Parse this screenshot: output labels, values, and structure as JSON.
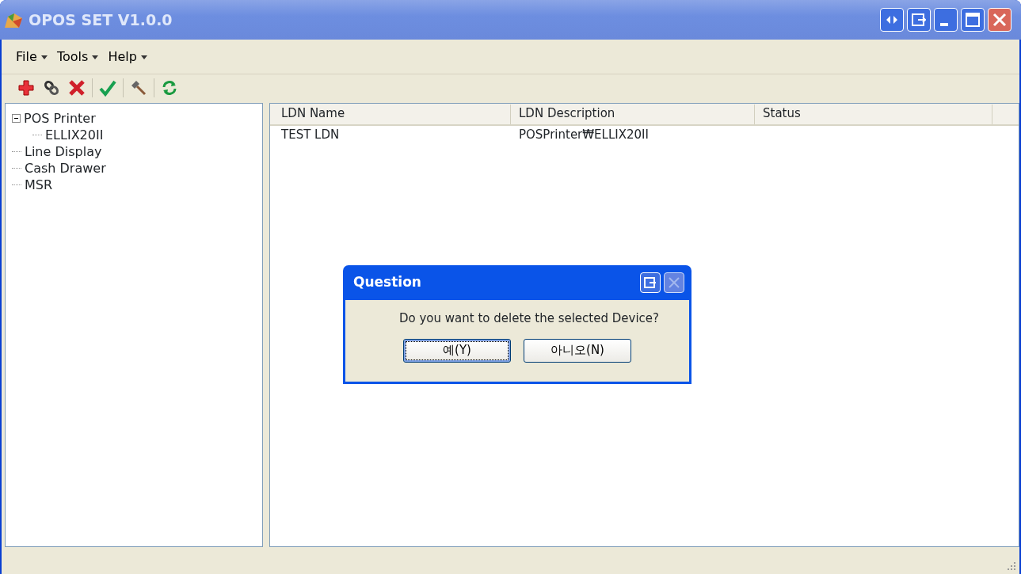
{
  "window": {
    "title": "OPOS SET V1.0.0"
  },
  "menu": [
    "File",
    "Tools",
    "Help"
  ],
  "tree": [
    {
      "label": "POS Printer",
      "expanded": true,
      "children": [
        {
          "label": "ELLIX20II"
        }
      ]
    },
    {
      "label": "Line Display"
    },
    {
      "label": "Cash Drawer"
    },
    {
      "label": "MSR"
    }
  ],
  "table": {
    "columns": [
      "LDN Name",
      "LDN Description",
      "Status"
    ],
    "rows": [
      [
        "TEST LDN",
        "POSPrinter₩ELLIX20II",
        ""
      ]
    ]
  },
  "dialog": {
    "title": "Question",
    "message": "Do you want to delete the selected Device?",
    "buttons": [
      {
        "label": "예(Y)",
        "focused": true
      },
      {
        "label": "아니오(N)",
        "focused": false
      }
    ]
  }
}
